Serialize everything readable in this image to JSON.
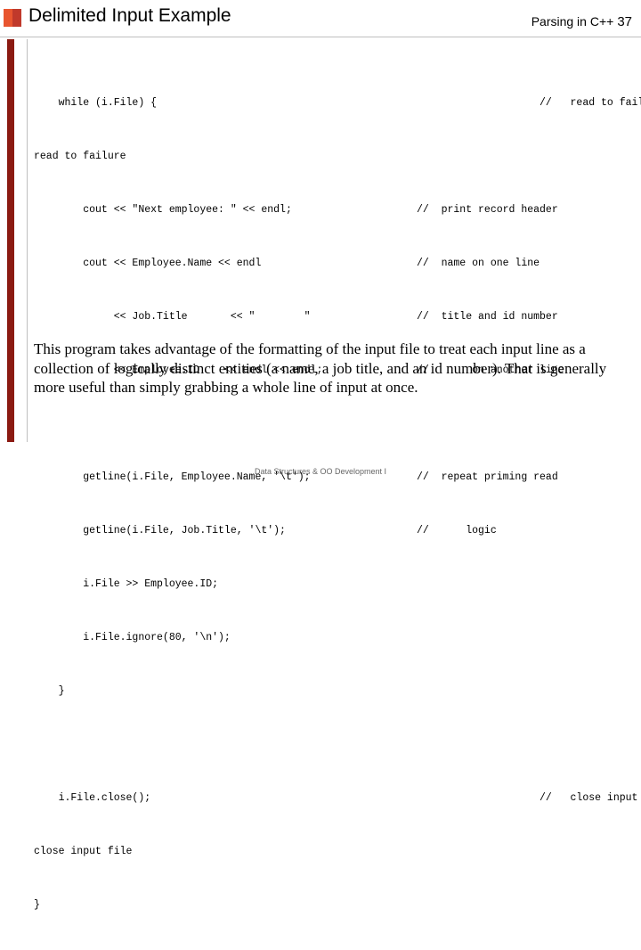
{
  "header": {
    "title": "Delimited Input Example",
    "right_text": "Parsing in C++",
    "page_number": "37"
  },
  "colors": {
    "accent_dark_red": "#8b1a12",
    "accent_red": "#c0392b",
    "accent_orange": "#e8552f",
    "rule": "#bfbfbf"
  },
  "code": {
    "lines": [
      {
        "left": "    while (i.File) {",
        "right": "                    //   read to failure"
      },
      {
        "left": "read to failure",
        "right": ""
      },
      {
        "left": "        cout << \"Next employee: \" << endl;",
        "right": "//  print record header"
      },
      {
        "left": "        cout << Employee.Name << endl",
        "right": "//  name on one line"
      },
      {
        "left": "             << Job.Title       << \"        \"",
        "right": "//  title and id number"
      },
      {
        "left": "             << Employee.ID    << endl << endl;",
        "right": "//       on another line"
      },
      {
        "left": "",
        "right": ""
      },
      {
        "left": "        getline(i.File, Employee.Name, '\\t');",
        "right": "//  repeat priming read"
      },
      {
        "left": "        getline(i.File, Job.Title, '\\t');",
        "right": "//      logic"
      },
      {
        "left": "        i.File >> Employee.ID;",
        "right": ""
      },
      {
        "left": "        i.File.ignore(80, '\\n');",
        "right": ""
      },
      {
        "left": "    }",
        "right": ""
      },
      {
        "left": "",
        "right": ""
      },
      {
        "left": "    i.File.close();",
        "right": "                    //   close input file"
      },
      {
        "left": "close input file",
        "right": ""
      },
      {
        "left": "}",
        "right": ""
      }
    ]
  },
  "paragraph": {
    "text": "This program takes advantage of the formatting of the input file to treat each input line as a collection of logically distinct entities (a name, a job title, and an id number).  That is generally more useful than simply grabbing a whole line of input at once."
  },
  "footer": {
    "text": "Data Structures & OO Development I"
  }
}
